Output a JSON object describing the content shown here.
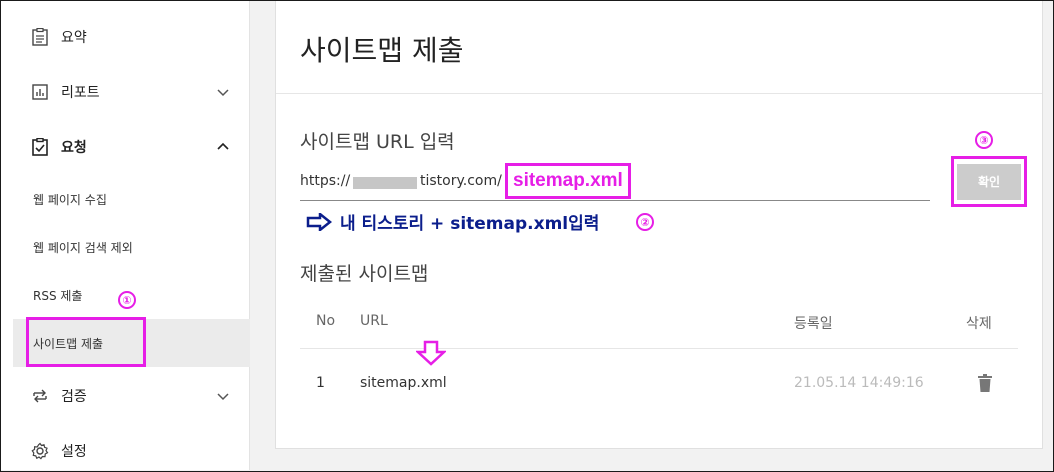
{
  "sidebar": {
    "items": [
      {
        "label": "요약",
        "icon": "clipboard-icon"
      },
      {
        "label": "리포트",
        "icon": "chart-icon",
        "expand": "chevron-down-icon"
      },
      {
        "label": "요청",
        "icon": "clipboard-check-icon",
        "expand": "chevron-up-icon"
      },
      {
        "label": "검증",
        "icon": "swap-icon",
        "expand": "chevron-down-icon"
      },
      {
        "label": "설정",
        "icon": "gear-icon"
      }
    ],
    "sub_items": [
      {
        "label": "웹 페이지 수집"
      },
      {
        "label": "웹 페이지 검색 제외"
      },
      {
        "label": "RSS 제출"
      },
      {
        "label": "사이트맵 제출"
      }
    ]
  },
  "main": {
    "title": "사이트맵 제출",
    "input_section_label": "사이트맵 URL 입력",
    "url_prefix": "https://",
    "url_host": "tistory.com/",
    "input_value": "sitemap.xml",
    "confirm_label": "확인",
    "instruction": "내 티스토리 + sitemap.xml입력",
    "submitted_label": "제출된 사이트맵",
    "table": {
      "headers": [
        "No",
        "URL",
        "등록일",
        "삭제"
      ],
      "rows": [
        {
          "no": "1",
          "url": "sitemap.xml",
          "date": "21.05.14 14:49:16"
        }
      ]
    }
  },
  "annotations": {
    "step1": "①",
    "step2": "②",
    "step3": "③",
    "color": "#e61ee6",
    "instruction_color": "#0b1e8c"
  }
}
